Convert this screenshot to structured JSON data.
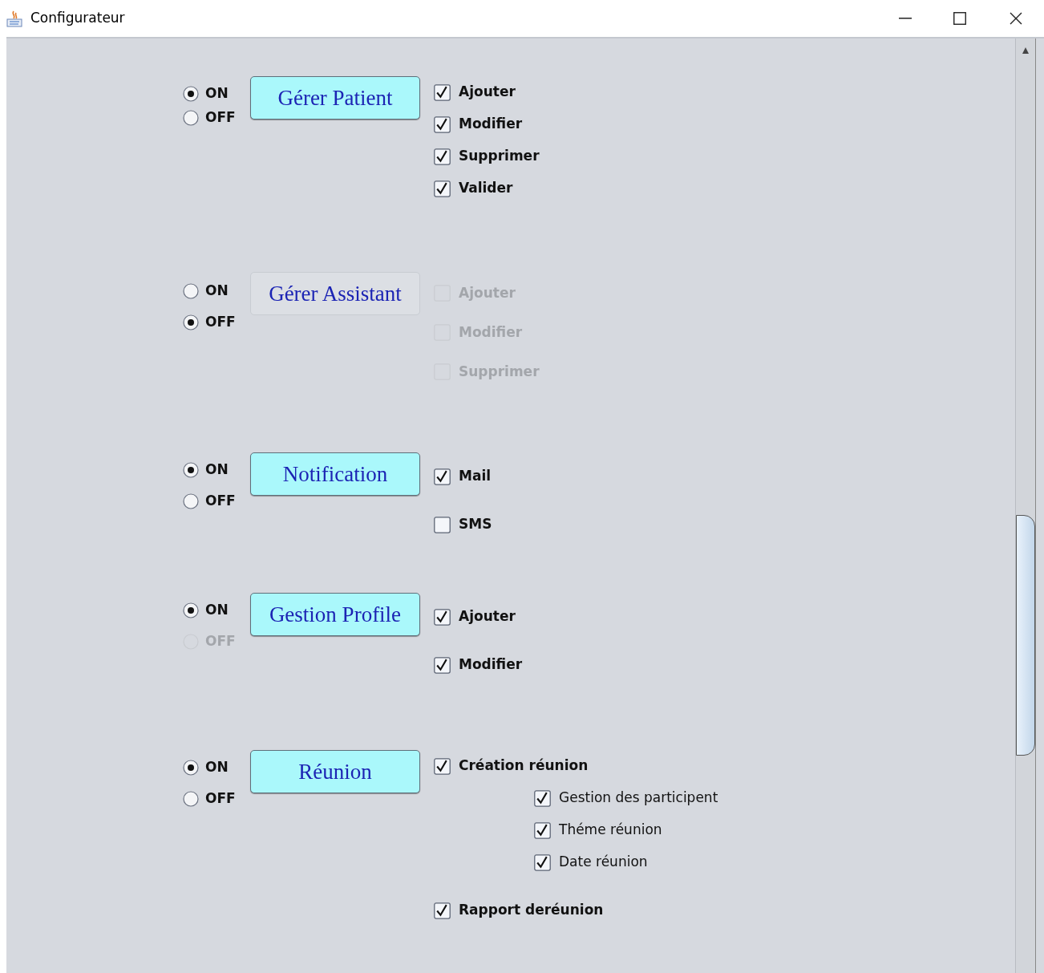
{
  "window": {
    "title": "Configurateur"
  },
  "sections": [
    {
      "button": {
        "label": "Gérer Patient"
      },
      "options": [
        {
          "label": "ON",
          "selected": true,
          "disabled": false
        },
        {
          "label": "OFF",
          "selected": false,
          "disabled": false
        }
      ],
      "items": [
        {
          "label": "Ajouter",
          "checked": true,
          "disabled": false
        },
        {
          "label": "Modifier",
          "checked": true,
          "disabled": false
        },
        {
          "label": "Supprimer",
          "checked": true,
          "disabled": false
        },
        {
          "label": "Valider",
          "checked": true,
          "disabled": false
        }
      ]
    },
    {
      "button": {
        "label": "Gérer Assistant"
      },
      "options": [
        {
          "label": "ON",
          "selected": false,
          "disabled": false
        },
        {
          "label": "OFF",
          "selected": true,
          "disabled": false
        }
      ],
      "items": [
        {
          "label": "Ajouter",
          "checked": false,
          "disabled": true
        },
        {
          "label": "Modifier",
          "checked": false,
          "disabled": true
        },
        {
          "label": "Supprimer",
          "checked": false,
          "disabled": true
        }
      ]
    },
    {
      "button": {
        "label": "Notification"
      },
      "options": [
        {
          "label": "ON",
          "selected": true,
          "disabled": false
        },
        {
          "label": "OFF",
          "selected": false,
          "disabled": false
        }
      ],
      "items": [
        {
          "label": "Mail",
          "checked": true,
          "disabled": false
        },
        {
          "label": "SMS",
          "checked": false,
          "disabled": false
        }
      ]
    },
    {
      "button": {
        "label": "Gestion Profile"
      },
      "options": [
        {
          "label": "ON",
          "selected": true,
          "disabled": false
        },
        {
          "label": "OFF",
          "selected": false,
          "disabled": true
        }
      ],
      "items": [
        {
          "label": "Ajouter",
          "checked": true,
          "disabled": false
        },
        {
          "label": "Modifier",
          "checked": true,
          "disabled": false
        }
      ]
    },
    {
      "button": {
        "label": "Réunion"
      },
      "options": [
        {
          "label": "ON",
          "selected": true,
          "disabled": false
        },
        {
          "label": "OFF",
          "selected": false,
          "disabled": false
        }
      ],
      "items": [
        {
          "label": "Création réunion",
          "checked": true,
          "disabled": false,
          "children": [
            {
              "label": "Gestion des participent",
              "checked": true,
              "disabled": false
            },
            {
              "label": "Théme réunion",
              "checked": true,
              "disabled": false
            },
            {
              "label": "Date réunion",
              "checked": true,
              "disabled": false
            }
          ]
        },
        {
          "label": "Rapport deréunion",
          "checked": true,
          "disabled": false
        }
      ]
    }
  ]
}
